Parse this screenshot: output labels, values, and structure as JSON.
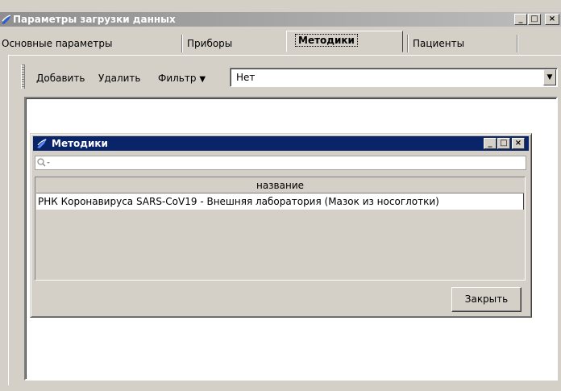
{
  "window": {
    "title": "Параметры загрузки данных",
    "controls": {
      "minimize": "_",
      "maximize": "□",
      "close": "×"
    }
  },
  "tabs": [
    {
      "label": "Основные параметры",
      "active": false
    },
    {
      "label": "Приборы",
      "active": false
    },
    {
      "label": "Методики",
      "active": true
    },
    {
      "label": "Пациенты",
      "active": false
    }
  ],
  "toolbar": {
    "add_label": "Добавить",
    "delete_label": "Удалить",
    "filter_label": "Фильтр",
    "filter_value": "Нет"
  },
  "inner_window": {
    "title": "Методики",
    "search_placeholder": "",
    "grid": {
      "columns": [
        "название"
      ],
      "rows": [
        [
          "РНК Коронавируса SARS-CoV19 - Внешняя лаборатория (Мазок из носоглотки)"
        ]
      ]
    },
    "close_label": "Закрыть"
  },
  "icons": {
    "app": "app-logo-icon",
    "search": "search-icon"
  },
  "colors": {
    "titlebar_inactive": "#8f8f8f",
    "titlebar_active": "#0a246a",
    "face": "#d4d0c8"
  }
}
